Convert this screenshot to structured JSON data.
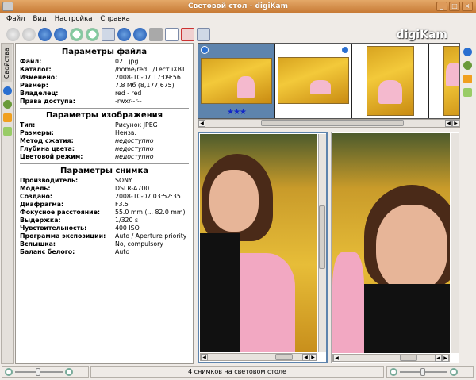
{
  "window": {
    "title": "Световой стол - digiKam",
    "logo": "digiKam"
  },
  "menu": [
    "Файл",
    "Вид",
    "Настройка",
    "Справка"
  ],
  "toolbar": {
    "icons": [
      "first-icon",
      "previous-disabled-icon",
      "next-icon",
      "last-icon",
      "zoom-in-icon",
      "zoom-out-icon",
      "fullscreen-icon",
      "left-arrow-icon",
      "right-arrow-icon",
      "sync-icon",
      "navigate-icon",
      "clear-icon",
      "slideshow-icon"
    ]
  },
  "left_tabs": {
    "properties": "Свойства"
  },
  "file_props": {
    "title": "Параметры файла",
    "rows": [
      {
        "k": "Файл:",
        "v": "021.jpg"
      },
      {
        "k": "Каталог:",
        "v": "/home/red.../Тест iXBT"
      },
      {
        "k": "Изменено:",
        "v": "2008-10-07 17:09:56"
      },
      {
        "k": "Размер:",
        "v": "7.8 Мб (8,177,675)"
      },
      {
        "k": "Владелец:",
        "v": "red - red"
      },
      {
        "k": "Права доступа:",
        "v": "-rwxr--r--"
      }
    ]
  },
  "image_props": {
    "title": "Параметры изображения",
    "rows": [
      {
        "k": "Тип:",
        "v": "Рисунок JPEG"
      },
      {
        "k": "Размеры:",
        "v": "Неизв."
      },
      {
        "k": "Метод сжатия:",
        "v": "недоступно"
      },
      {
        "k": "Глубина цвета:",
        "v": "недоступно"
      },
      {
        "k": "Цветовой режим:",
        "v": "недоступно"
      }
    ]
  },
  "photo_props": {
    "title": "Параметры снимка",
    "rows": [
      {
        "k": "Производитель:",
        "v": "SONY"
      },
      {
        "k": "Модель:",
        "v": "DSLR-A700"
      },
      {
        "k": "Создано:",
        "v": "2008-10-07 03:52:35"
      },
      {
        "k": "Диафрагма:",
        "v": "F3.5"
      },
      {
        "k": "Фокусное расстояние:",
        "v": "55.0 mm (... 82.0 mm)"
      },
      {
        "k": "Выдержка:",
        "v": "1/320 s"
      },
      {
        "k": "Чувствительность:",
        "v": "400 ISO"
      },
      {
        "k": "Программа экспозиции:",
        "v": "Auto / Aperture priority"
      },
      {
        "k": "Вспышка:",
        "v": "No, compulsory"
      },
      {
        "k": "Баланс белого:",
        "v": "Auto"
      }
    ]
  },
  "thumbnails": [
    {
      "rating": "★★★",
      "selected": true
    },
    {
      "rating": ""
    },
    {
      "rating": ""
    },
    {
      "rating": "★★"
    }
  ],
  "status": {
    "text": "4 снимков на световом столе"
  },
  "colors": {
    "titlebar": "#d08b45",
    "selection": "#5e84ad",
    "stars": "#1227c8"
  }
}
